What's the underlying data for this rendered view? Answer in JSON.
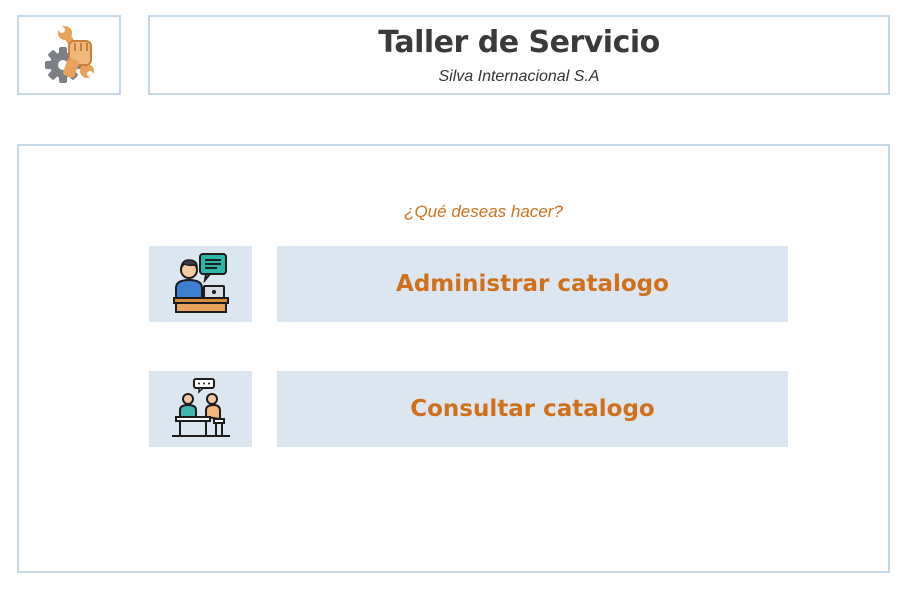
{
  "header": {
    "logo_icon": "wrench-gear-hand-icon",
    "title": "Taller de Servicio",
    "subtitle": "Silva Internacional S.A"
  },
  "main": {
    "question": "¿Qué deseas hacer?",
    "actions": [
      {
        "icon": "person-laptop-chat-icon",
        "label": "Administrar catalogo"
      },
      {
        "icon": "two-people-conversation-icon",
        "label": "Consultar catalogo"
      }
    ]
  },
  "colors": {
    "border": "#c5d9ea",
    "tile_bg": "#dce6f1",
    "accent": "#d0701a",
    "title": "#3a3a3a"
  }
}
